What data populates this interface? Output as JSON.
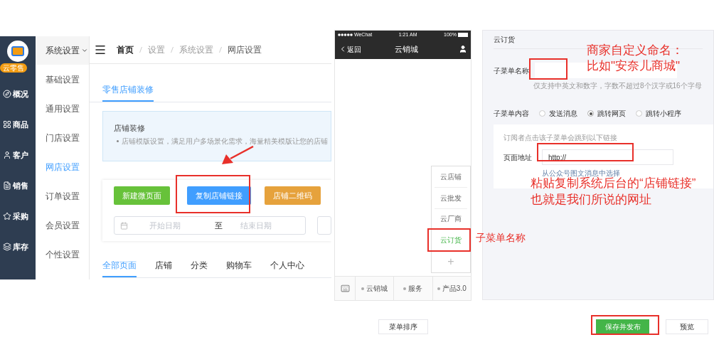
{
  "admin": {
    "brand": "云零售",
    "nav": [
      {
        "label": "概况",
        "selected": false
      },
      {
        "label": "商品",
        "selected": false
      },
      {
        "label": "客户",
        "selected": false
      },
      {
        "label": "销售",
        "selected": false
      },
      {
        "label": "采购",
        "selected": false
      },
      {
        "label": "库存",
        "selected": false
      }
    ],
    "submenu_title": "系统设置",
    "submenu": [
      {
        "label": "基础设置",
        "selected": false
      },
      {
        "label": "通用设置",
        "selected": false
      },
      {
        "label": "门店设置",
        "selected": false
      },
      {
        "label": "网店设置",
        "selected": true
      },
      {
        "label": "订单设置",
        "selected": false
      },
      {
        "label": "会员设置",
        "selected": false
      },
      {
        "label": "个性设置",
        "selected": false
      }
    ],
    "breadcrumb": [
      "首页",
      "设置",
      "系统设置",
      "网店设置"
    ],
    "tabs": [
      {
        "label": "零售店铺装修",
        "selected": true
      }
    ],
    "notice": {
      "title": "店铺装修",
      "text": "店铺模版设置，满足用户多场景化需求，海量精美模版让您的店铺"
    },
    "buttons": [
      {
        "label": "新建微页面",
        "kind": "success"
      },
      {
        "label": "复制店铺链接",
        "kind": "primary"
      },
      {
        "label": "店铺二维码",
        "kind": "warning"
      }
    ],
    "date_range": {
      "start_placeholder": "开始日期",
      "separator": "至",
      "end_placeholder": "结束日期"
    },
    "page_tabs": [
      {
        "label": "全部页面",
        "selected": true
      },
      {
        "label": "店铺",
        "selected": false
      },
      {
        "label": "分类",
        "selected": false
      },
      {
        "label": "购物车",
        "selected": false
      },
      {
        "label": "个人中心",
        "selected": false
      }
    ]
  },
  "phone": {
    "status": {
      "carrier": "WeChat",
      "time": "1:21 AM",
      "battery": "100%"
    },
    "back": "返回",
    "title": "云销城",
    "submenu": [
      {
        "label": "云店铺",
        "selected": false
      },
      {
        "label": "云批发",
        "selected": false
      },
      {
        "label": "云厂商",
        "selected": false
      },
      {
        "label": "云订货",
        "selected": true
      }
    ],
    "add": "+",
    "menu": [
      {
        "label": "云销城"
      },
      {
        "label": "服务"
      },
      {
        "label": "产品3.0"
      }
    ]
  },
  "editor": {
    "heading": "云订货",
    "name_label": "子菜单名称",
    "name_hint": "仅支持中英文和数字，字数不超过8个汉字或16个字母",
    "content_label": "子菜单内容",
    "options": [
      {
        "label": "发送消息",
        "selected": false
      },
      {
        "label": "跳转网页",
        "selected": true
      },
      {
        "label": "跳转小程序",
        "selected": false
      }
    ],
    "link_hint": "订阅者点击该子菜单会跳到以下链接",
    "url_label": "页面地址",
    "url_value": "http://",
    "select_link": "从公众号图文消息中选择"
  },
  "footer": {
    "sort_button": "菜单排序",
    "save_button": "保存并发布",
    "preview_button": "预览"
  },
  "annotations": [
    {
      "lines": [
        "商家自定义命名：",
        "比如\"安奈儿商城\""
      ]
    },
    {
      "lines": [
        "粘贴复制系统后台的“店铺链接”",
        "也就是我们所说的网址"
      ]
    },
    {
      "lines": [
        "子菜单名称"
      ]
    }
  ]
}
